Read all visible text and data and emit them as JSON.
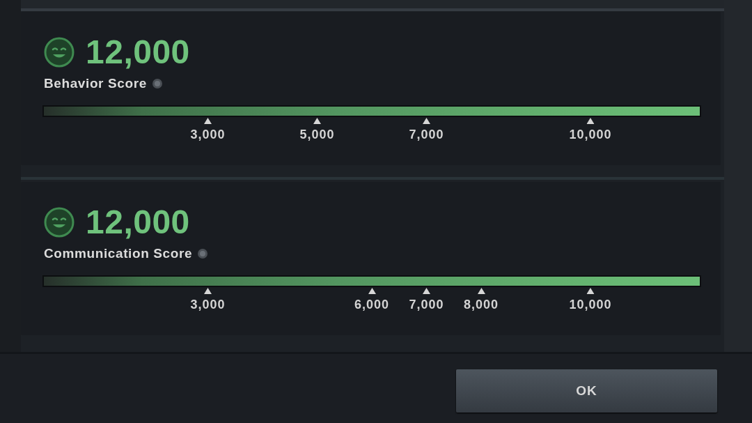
{
  "scores": [
    {
      "value": "12,000",
      "label": "Behavior Score",
      "level": 1,
      "markers": [
        {
          "label": "3,000",
          "level": 0.25
        },
        {
          "label": "5,000",
          "level": 0.4167
        },
        {
          "label": "7,000",
          "level": 0.5833
        },
        {
          "label": "10,000",
          "level": 0.8333
        }
      ]
    },
    {
      "value": "12,000",
      "label": "Communication Score",
      "level": 1,
      "markers": [
        {
          "label": "3,000",
          "level": 0.25
        },
        {
          "label": "6,000",
          "level": 0.5
        },
        {
          "label": "7,000",
          "level": 0.5833
        },
        {
          "label": "8,000",
          "level": 0.6667
        },
        {
          "label": "10,000",
          "level": 0.8333
        }
      ]
    }
  ],
  "ok_button": {
    "label": "OK"
  }
}
